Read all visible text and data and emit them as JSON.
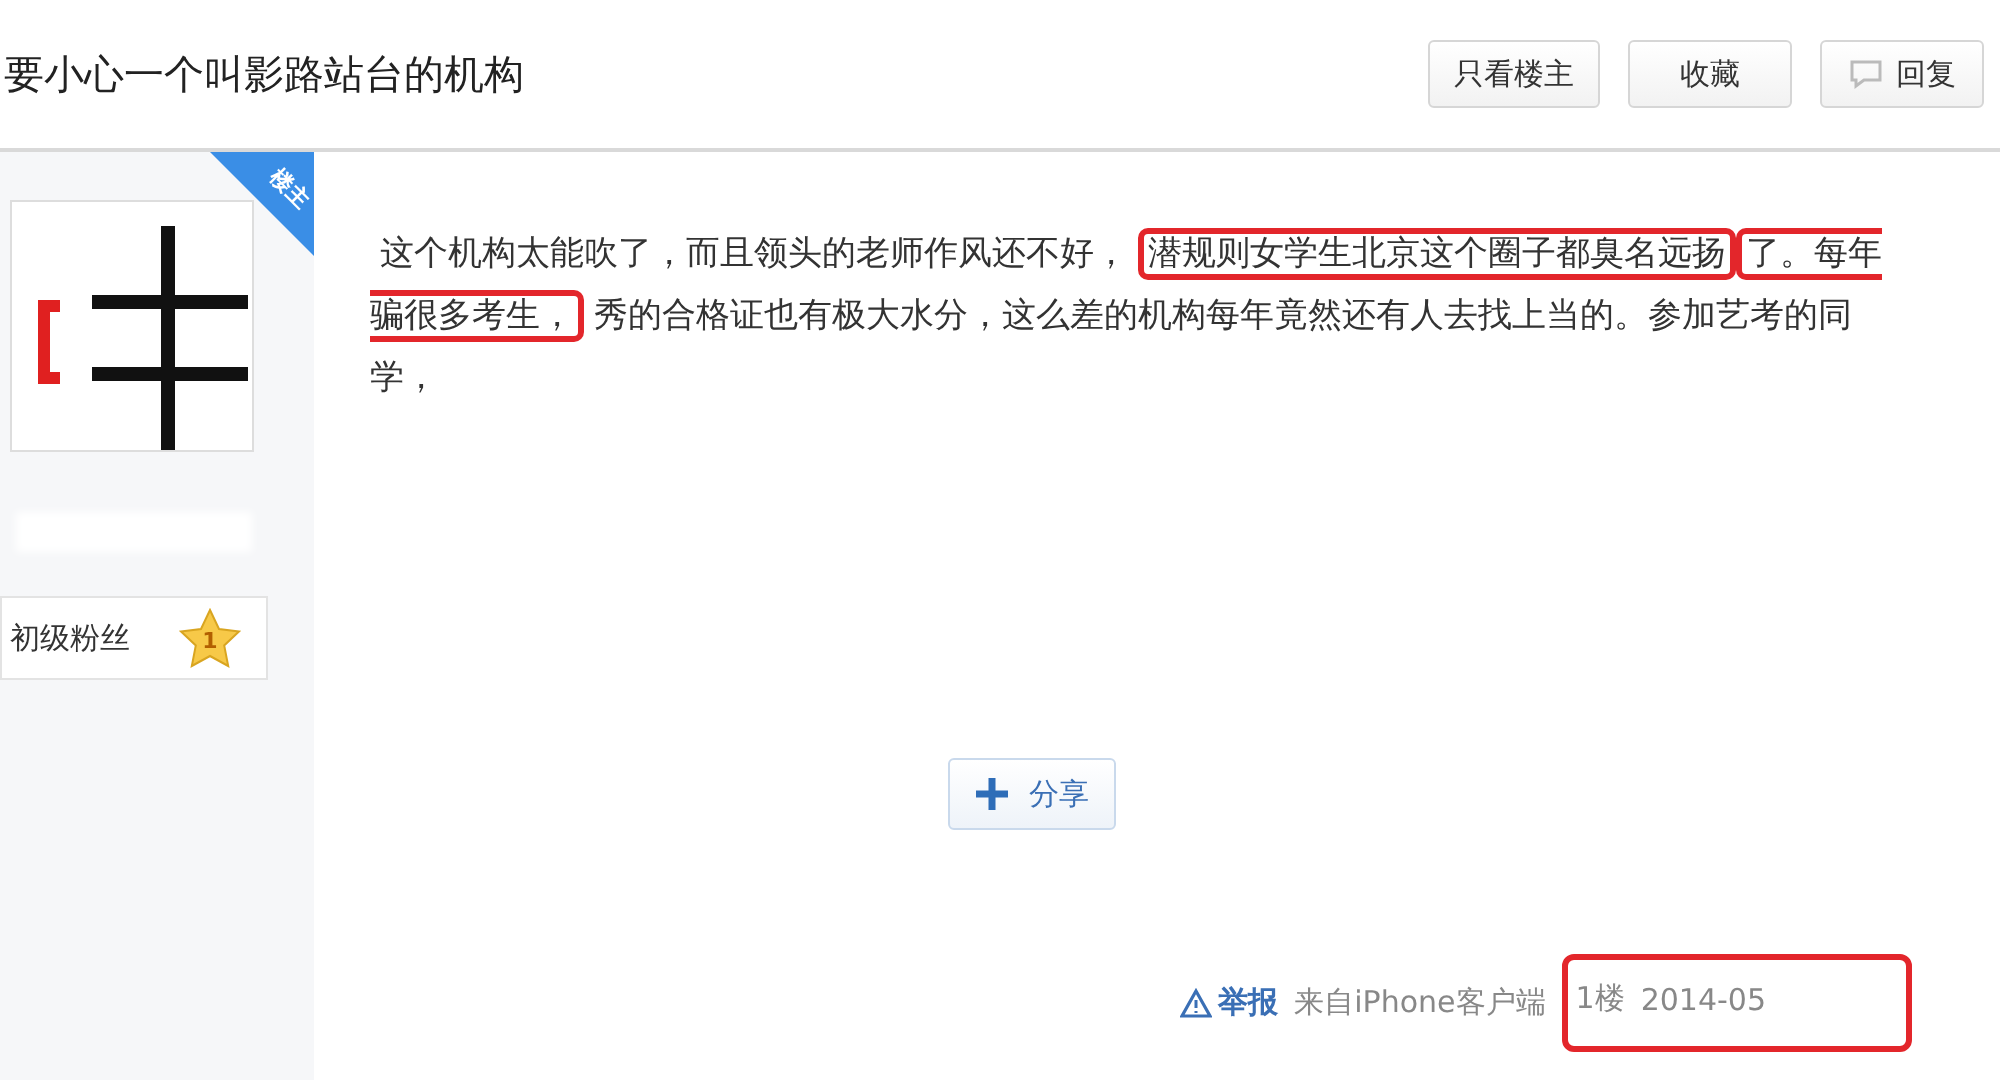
{
  "thread_title": "要小心一个叫影路站台的机构",
  "header_buttons": [
    {
      "label": "只看楼主",
      "kind": "plain"
    },
    {
      "label": "收藏",
      "kind": "plain"
    },
    {
      "label": "回复",
      "kind": "reply"
    }
  ],
  "author": {
    "badge": "楼主",
    "level_title": "初级粉丝",
    "level": "1"
  },
  "post_segments": [
    {
      "text": "这个机构太能吹了，而且领头的老师作风还不好，",
      "highlighted": false
    },
    {
      "text": "潜规则女学生北京这个圈子都臭名远扬",
      "highlighted": true
    },
    {
      "text": "了。每年骗很多考生，",
      "highlighted": true
    },
    {
      "text": "秀的合格证也有极大水分，这么差的机构每年竟然还有人去找上当的。参加艺考的同学，",
      "highlighted": false
    }
  ],
  "share_button": "分享",
  "footer": {
    "report": "举报",
    "source": "来自iPhone客户端",
    "floor": "1楼",
    "date": "2014-05",
    "highlighted": true
  }
}
